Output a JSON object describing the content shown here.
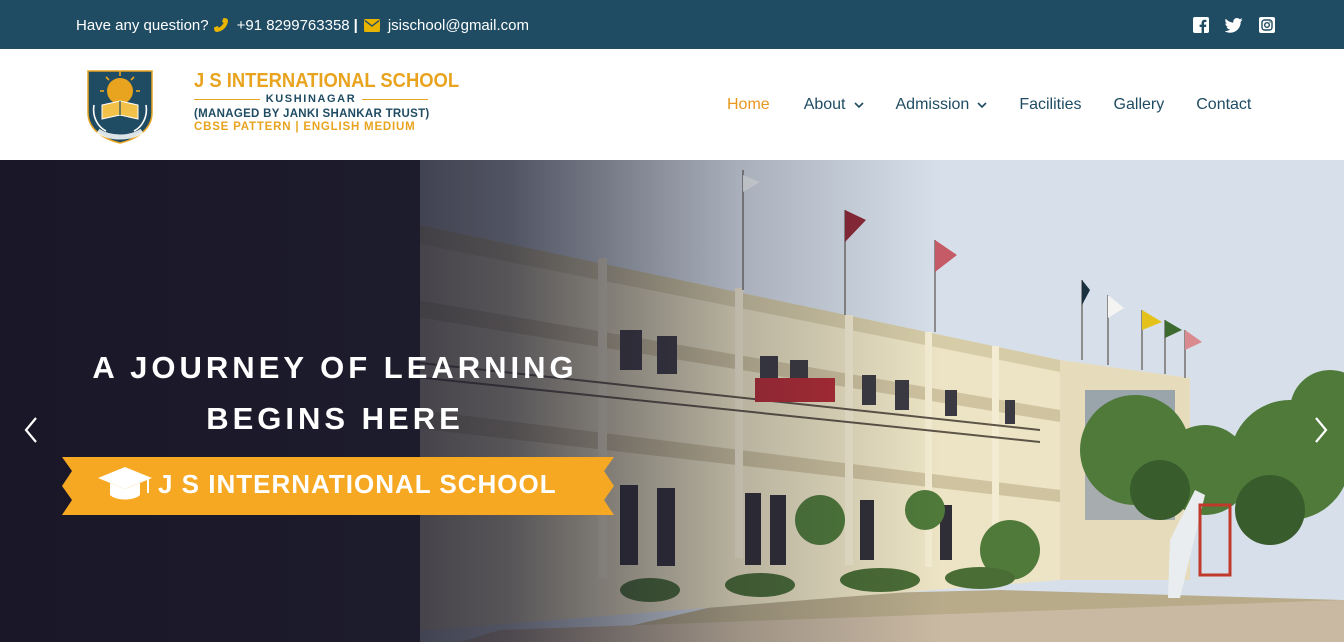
{
  "topbar": {
    "question": "Have any question?",
    "phone": "+91 8299763358",
    "separator": "|",
    "email": "jsischool@gmail.com",
    "icons": [
      "phone-icon",
      "envelope-icon",
      "facebook-icon",
      "twitter-icon",
      "instagram-icon"
    ],
    "colors": {
      "background": "#1f4c63",
      "icon_accent": "#e8b400"
    }
  },
  "logo": {
    "name": "J S INTERNATIONAL SCHOOL",
    "location": "KUSHINAGAR",
    "trust": "(MANAGED BY JANKI SHANKAR TRUST)",
    "pattern": "CBSE PATTERN | ENGLISH MEDIUM"
  },
  "nav": {
    "items": [
      {
        "label": "Home",
        "active": true
      },
      {
        "label": "About",
        "has_dropdown": true
      },
      {
        "label": "Admission",
        "has_dropdown": true
      },
      {
        "label": "Facilities"
      },
      {
        "label": "Gallery"
      },
      {
        "label": "Contact"
      }
    ],
    "colors": {
      "text": "#1f4c63",
      "active": "#e8961f"
    }
  },
  "hero": {
    "headline_line1": "A JOURNEY OF LEARNING",
    "headline_line2": "BEGINS HERE",
    "banner_text": "J S INTERNATIONAL SCHOOL",
    "banner_icon": "graduation-cap-icon",
    "colors": {
      "banner": "#f7a823"
    },
    "controls": [
      "previous-slide-arrow",
      "next-slide-arrow"
    ]
  }
}
